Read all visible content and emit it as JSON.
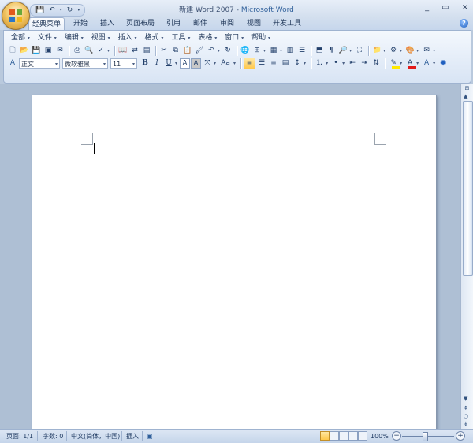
{
  "title": {
    "doc": "新建 Word 2007",
    "sep": " - ",
    "app": "Microsoft Word"
  },
  "qat": {
    "save": "💾",
    "undo": "↶",
    "undo_dd": "▾",
    "redo": "↻",
    "customize": "▾"
  },
  "window_controls": {
    "minimize": "_",
    "restore": "▭",
    "close": "×"
  },
  "tabs": [
    "经典菜单",
    "开始",
    "插入",
    "页面布局",
    "引用",
    "邮件",
    "审阅",
    "视图",
    "开发工具"
  ],
  "help": "?",
  "menu": [
    "全部",
    "文件",
    "编辑",
    "视图",
    "插入",
    "格式",
    "工具",
    "表格",
    "窗口",
    "帮助"
  ],
  "toolbar": {
    "style_value": "正文",
    "font_value": "微软雅黑",
    "size_value": "11",
    "bold": "B",
    "italic": "I",
    "underline": "U",
    "char_border": "A",
    "char_shading": "A",
    "change_case": "Aa",
    "font_color_letter": "A"
  },
  "colors": {
    "highlight": "#ffe900",
    "font_color": "#e21a1a",
    "accent_blue": "#2f5f9a"
  },
  "status": {
    "page": "页面: 1/1",
    "words": "字数: 0",
    "language": "中文(简体，中国)",
    "mode": "插入",
    "zoom": "100%",
    "zoom_out": "−",
    "zoom_in": "+"
  },
  "zoom_level_percent": 100
}
